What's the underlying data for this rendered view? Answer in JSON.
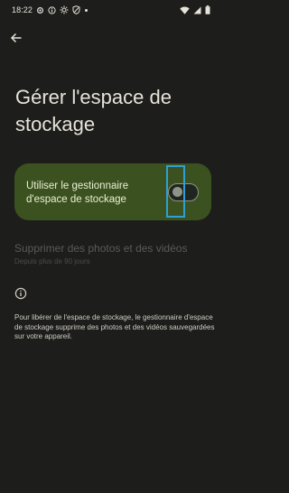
{
  "status_bar": {
    "time": "18:22"
  },
  "header": {
    "back_icon": "arrow-left-icon"
  },
  "page": {
    "title": "Gérer l'espace de stockage"
  },
  "storage_manager": {
    "label": "Utiliser le gestionnaire d'espace de stockage",
    "toggle_state": "off"
  },
  "delete_item": {
    "title": "Supprimer des photos et des vidéos",
    "subtitle": "Depuis plus de 90 jours",
    "enabled": false
  },
  "info": {
    "icon": "info-icon",
    "text": "Pour libérer de l'espace de stockage, le gestionnaire d'espace de stockage supprime des photos et des vidéos sauvegardées sur votre appareil."
  },
  "colors": {
    "background": "#1d1d1b",
    "card": "#3b5220",
    "highlight": "#2f9fd4"
  }
}
